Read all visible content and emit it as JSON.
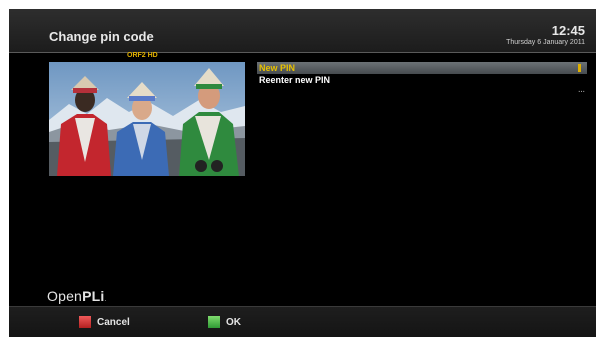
{
  "header": {
    "title": "Change pin code",
    "time": "12:45",
    "date": "Thursday 6 January 2011"
  },
  "preview": {
    "channel_name": "ORF2 HD"
  },
  "menu": {
    "items": [
      {
        "label": "New PIN",
        "selected": true
      },
      {
        "label": "Reenter new PIN",
        "selected": false
      }
    ]
  },
  "brand": {
    "logo_light": "Open",
    "logo_bold": "PLi"
  },
  "footer": {
    "cancel_label": "Cancel",
    "ok_label": "OK",
    "cancel_color": "#d63a3a",
    "ok_color": "#47b847"
  },
  "colors": {
    "accent_yellow": "#e8c100",
    "selection_bar": "#5a6065"
  }
}
